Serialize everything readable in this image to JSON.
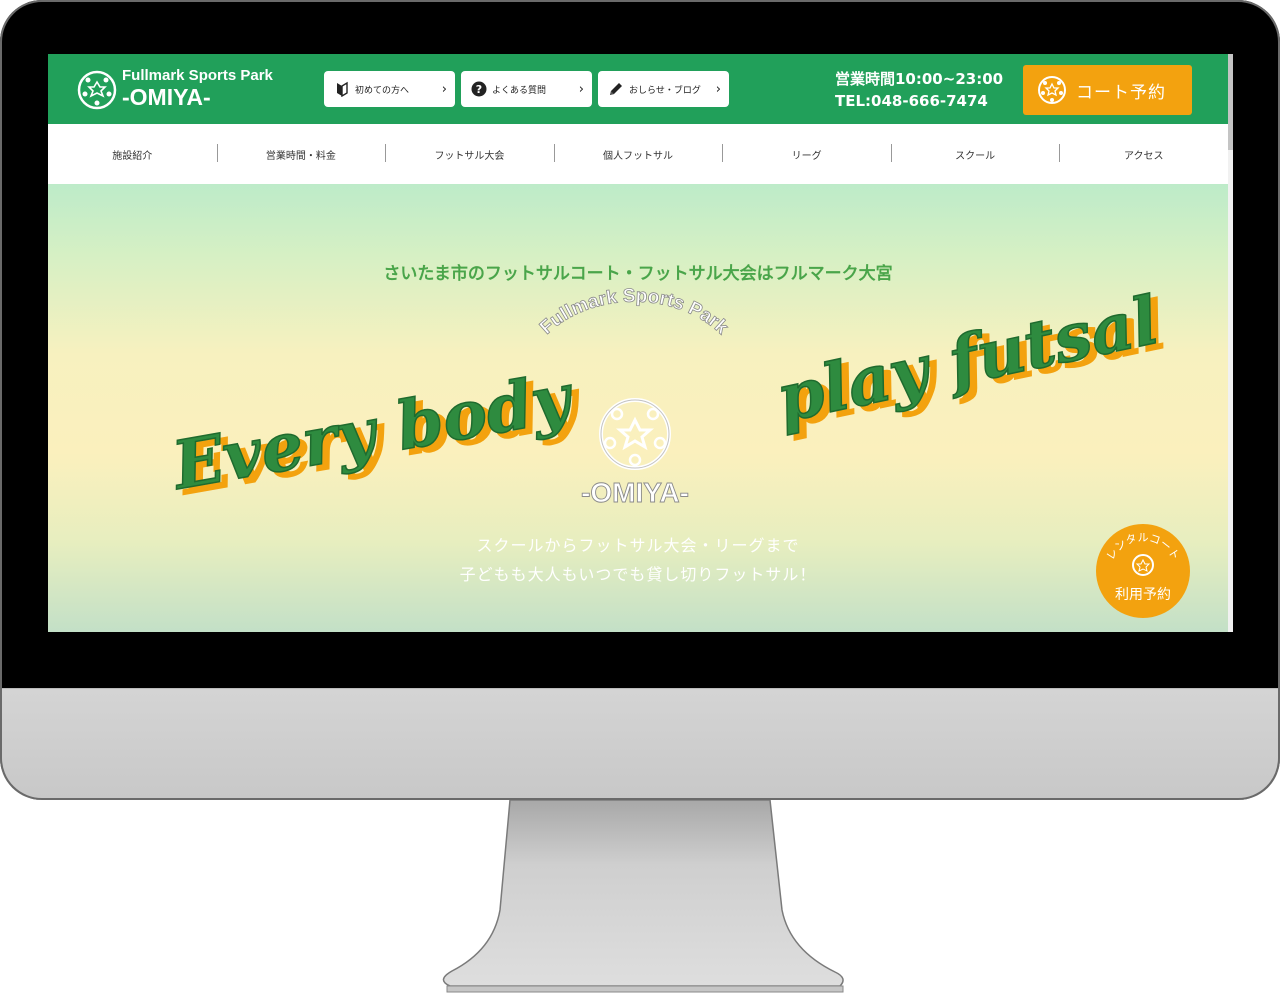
{
  "header": {
    "logo_top": "Fullmark Sports Park",
    "logo_bottom": "-OMIYA-",
    "buttons": [
      {
        "label": "初めての方へ",
        "icon": "beginner-mark-icon"
      },
      {
        "label": "よくある質問",
        "icon": "question-circle-icon"
      },
      {
        "label": "おしらせ・ブログ",
        "icon": "pencil-icon"
      }
    ],
    "hours": "営業時間10:00~23:00",
    "tel": "TEL:048-666-7474",
    "reserve_label": "コート予約"
  },
  "nav": {
    "items": [
      "施設紹介",
      "営業時間・料金",
      "フットサル大会",
      "個人フットサル",
      "リーグ",
      "スクール",
      "アクセス"
    ]
  },
  "hero": {
    "tagline": "さいたま市のフットサルコート・フットサル大会はフルマーク大宮",
    "left_script": "Every body",
    "right_script": "play futsal",
    "center_logo_top": "Fullmark Sports Park",
    "center_logo_bottom": "-OMIYA-",
    "sub_line1": "スクールからフットサル大会・リーグまで",
    "sub_line2": "子どもも大人もいつでも貸し切りフットサル！"
  },
  "float_button": {
    "arc_label": "レンタルコート",
    "label": "利用予約"
  },
  "colors": {
    "brand_green": "#21a05a",
    "accent_orange": "#f3a20f",
    "script_green": "#2e8b3f",
    "tagline_green": "#4aa54a"
  }
}
